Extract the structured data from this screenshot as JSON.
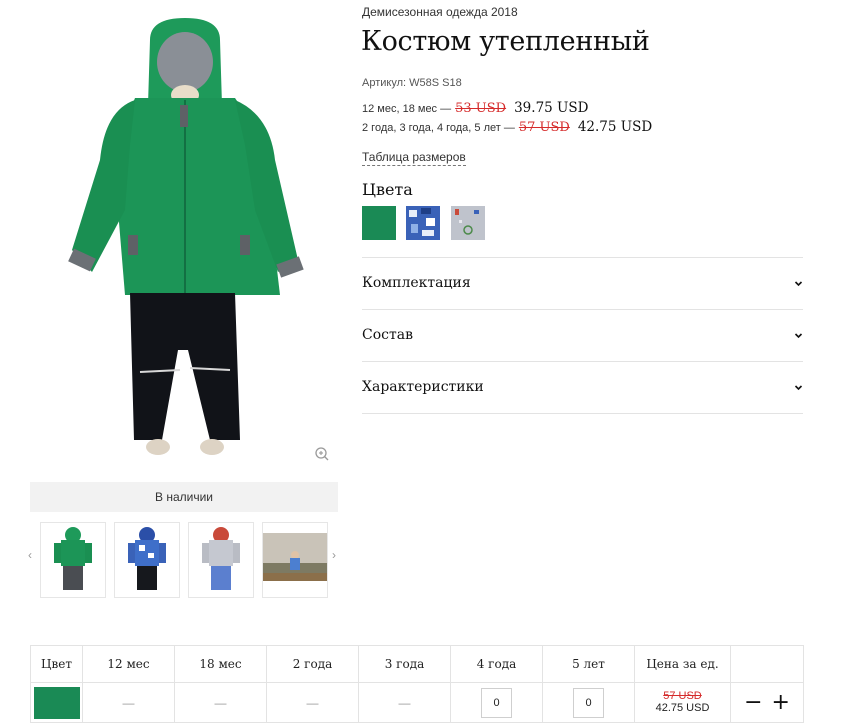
{
  "gallery": {
    "stock_label": "В наличии",
    "prev_arrow": "‹",
    "next_arrow": "›",
    "thumbnails": [
      {
        "name": "green-suit"
      },
      {
        "name": "blue-print-suit"
      },
      {
        "name": "grey-suit"
      },
      {
        "name": "lifestyle-photo"
      }
    ]
  },
  "product": {
    "category": "Демисезонная одежда 2018",
    "title": "Костюм утепленный",
    "sku": "Артикул: W58S S18",
    "prices": [
      {
        "sizes": "12 мес, 18 мес —",
        "old": "53 USD",
        "new": "39.75 USD"
      },
      {
        "sizes": "2 года, 3 года, 4 года, 5 лет —",
        "old": "57 USD",
        "new": "42.75 USD"
      }
    ],
    "size_chart_link": "Таблица размеров",
    "colors_heading": "Цвета",
    "colors": [
      {
        "name": "green",
        "hex": "#1a8a55"
      },
      {
        "name": "blue-print",
        "hex": "#3a5fb5"
      },
      {
        "name": "grey-print",
        "hex": "#b8bcc8"
      }
    ]
  },
  "accordion": [
    {
      "label": "Комплектация"
    },
    {
      "label": "Состав"
    },
    {
      "label": "Характеристики"
    }
  ],
  "size_table": {
    "headers": [
      "Цвет",
      "12 мес",
      "18 мес",
      "2 года",
      "3 года",
      "4 года",
      "5 лет",
      "Цена за ед.",
      ""
    ],
    "row": {
      "color_hex": "#1a8a55",
      "cells": [
        "—",
        "—",
        "—",
        "—"
      ],
      "qty_4": "0",
      "qty_5": "0",
      "unit_old": "57 USD",
      "unit_new": "42.75 USD",
      "minus": "−",
      "plus": "+"
    }
  },
  "icons": {
    "zoom": "zoom-in-icon",
    "chevron": "chevron-down-icon"
  }
}
